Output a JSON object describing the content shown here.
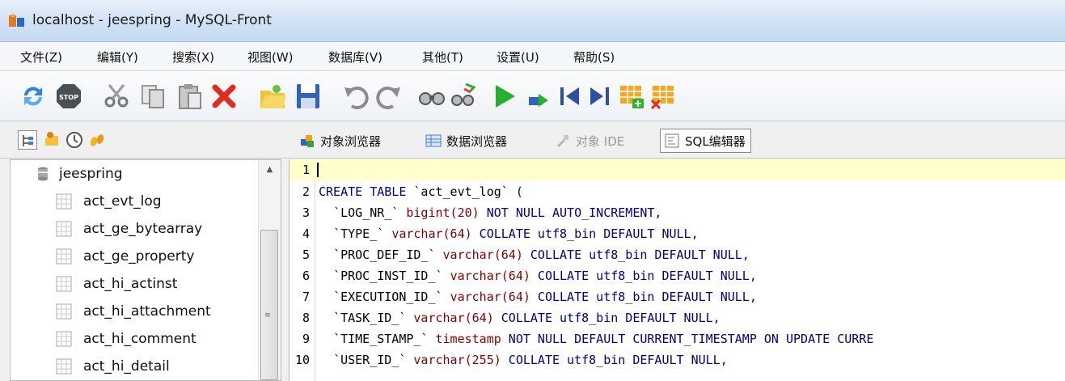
{
  "window": {
    "title": "localhost - jeespring - MySQL-Front"
  },
  "menu": [
    "文件(Z)",
    "编辑(Y)",
    "搜索(X)",
    "视图(W)",
    "数据库(V)",
    "其他(T)",
    "设置(U)",
    "帮助(S)"
  ],
  "toolbar_icons": [
    "refresh-icon",
    "stop-icon",
    "cut-icon",
    "copy-icon",
    "paste-icon",
    "delete-icon",
    "open-icon",
    "save-icon",
    "undo-icon",
    "redo-icon",
    "find-icon",
    "replace-icon",
    "run-icon",
    "run-line-icon",
    "first-icon",
    "last-icon",
    "add-row-icon",
    "delete-row-icon"
  ],
  "left_icons": [
    "tree-view-icon",
    "favorites-icon",
    "history-icon",
    "sql-tags-icon"
  ],
  "view_tabs": [
    {
      "label": "对象浏览器",
      "icon": "object-browser-icon",
      "state": "normal"
    },
    {
      "label": "数据浏览器",
      "icon": "data-browser-icon",
      "state": "normal"
    },
    {
      "label": "对象 IDE",
      "icon": "object-ide-icon",
      "state": "disabled"
    },
    {
      "label": "SQL编辑器",
      "icon": "sql-editor-icon",
      "state": "active"
    }
  ],
  "tree": {
    "database": "jeespring",
    "tables": [
      "act_evt_log",
      "act_ge_bytearray",
      "act_ge_property",
      "act_hi_actinst",
      "act_hi_attachment",
      "act_hi_comment",
      "act_hi_detail"
    ]
  },
  "editor": {
    "line_numbers": [
      "1",
      "2",
      "3",
      "4",
      "5",
      "6",
      "7",
      "8",
      "9",
      "10"
    ],
    "lines": [
      "",
      "CREATE TABLE `act_evt_log` (",
      "  `LOG_NR_` bigint(20) NOT NULL AUTO_INCREMENT,",
      "  `TYPE_` varchar(64) COLLATE utf8_bin DEFAULT NULL,",
      "  `PROC_DEF_ID_` varchar(64) COLLATE utf8_bin DEFAULT NULL,",
      "  `PROC_INST_ID_` varchar(64) COLLATE utf8_bin DEFAULT NULL,",
      "  `EXECUTION_ID_` varchar(64) COLLATE utf8_bin DEFAULT NULL,",
      "  `TASK_ID_` varchar(64) COLLATE utf8_bin DEFAULT NULL,",
      "  `TIME_STAMP_` timestamp NOT NULL DEFAULT CURRENT_TIMESTAMP ON UPDATE CURRE",
      "  `USER_ID_` varchar(255) COLLATE utf8_bin DEFAULT NULL,"
    ]
  },
  "colors": {
    "keyword": "#000080",
    "type": "#800000",
    "current_line": "#ffffcc"
  }
}
